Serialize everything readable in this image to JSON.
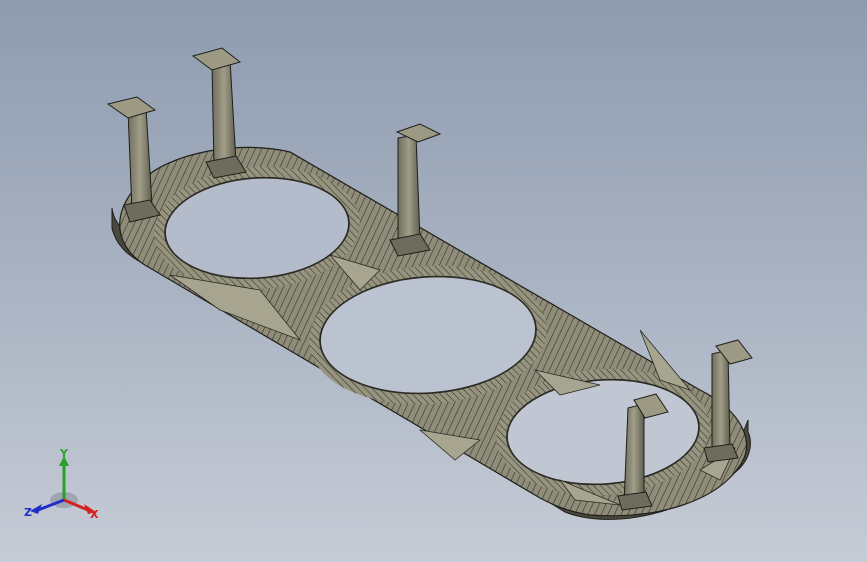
{
  "viewport": {
    "name": "3d-model-viewport"
  },
  "model": {
    "type": "perforated plate with 5 standoff posts",
    "holes": 3,
    "posts": 5,
    "render_style": "shaded with tessellation edges",
    "body_color": "#8f8d79",
    "edge_color": "#2b2a24"
  },
  "triad": {
    "x_label": "X",
    "y_label": "Y",
    "z_label": "Z",
    "x_color": "#d42020",
    "y_color": "#2aa02a",
    "z_color": "#2030c8"
  }
}
